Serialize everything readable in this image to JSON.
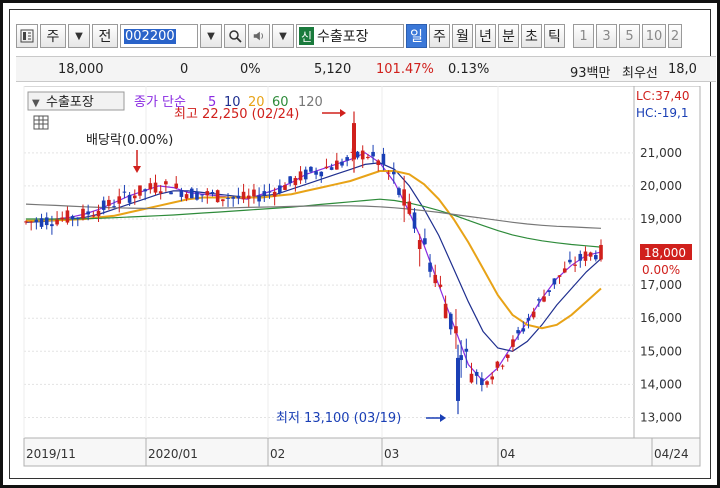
{
  "toolbar": {
    "market_label": "주",
    "jeon_label": "전",
    "stock_code": "002200",
    "stock_name_badge": "신",
    "stock_name": "수출포장",
    "periods": [
      "일",
      "주",
      "월",
      "년",
      "분",
      "초",
      "틱"
    ],
    "active_period": "일",
    "numbers": [
      "1",
      "3",
      "5",
      "10",
      "2"
    ]
  },
  "quote": {
    "price": "18,000",
    "change": "0",
    "change_pct": "0%",
    "volume": "5,120",
    "vol_ratio": "101.47%",
    "turnover": "0.13%",
    "amount": "93백만",
    "best_bid_label": "최우선",
    "best_bid": "18,0"
  },
  "chart": {
    "series_label": "수출포장",
    "ma_label": "종가 단순",
    "ma_periods": [
      {
        "label": "5",
        "color": "#8a2be2"
      },
      {
        "label": "10",
        "color": "#1f2f8f"
      },
      {
        "label": "20",
        "color": "#e8a317"
      },
      {
        "label": "60",
        "color": "#2e8b3a"
      },
      {
        "label": "120",
        "color": "#777777"
      }
    ],
    "lc_label": "LC:37,40",
    "hc_label": "HC:-19,1",
    "high_label": "최고 22,250 (02/24)",
    "low_label": "최저 13,100 (03/19)",
    "dividend_label": "배당락(0.00%)",
    "current_price": "18,000",
    "current_pct": "0.00%",
    "up_color": "#d0201c",
    "down_color": "#1a3fb5"
  },
  "chart_data": {
    "type": "candlestick",
    "ylim": [
      12500,
      22900
    ],
    "y_ticks": [
      "21,000",
      "20,000",
      "19,000",
      "17,000",
      "16,000",
      "15,000",
      "14,000",
      "13,000"
    ],
    "x_ticks": [
      "2019/11",
      "2020/01",
      "02",
      "03",
      "04",
      "04/24"
    ],
    "series": [
      {
        "name": "5",
        "values": [
          18900,
          18950,
          19000,
          19050,
          19150,
          19300,
          19500,
          19700,
          19850,
          20000,
          19950,
          19800,
          19750,
          19700,
          19650,
          19600,
          19750,
          19900,
          20100,
          20350,
          20500,
          20650,
          20800,
          21000,
          20700,
          20100,
          19200,
          18200,
          17000,
          15800,
          14600,
          14100,
          14500,
          15200,
          15900,
          16600,
          17200,
          17600,
          17900,
          18000
        ]
      },
      {
        "name": "10",
        "values": [
          18900,
          18920,
          18950,
          19000,
          19050,
          19150,
          19300,
          19450,
          19600,
          19750,
          19850,
          19850,
          19800,
          19750,
          19700,
          19650,
          19700,
          19750,
          19900,
          20050,
          20200,
          20350,
          20500,
          20650,
          20700,
          20500,
          20000,
          19300,
          18500,
          17500,
          16500,
          15600,
          15100,
          15000,
          15300,
          15800,
          16400,
          16900,
          17400,
          17800
        ]
      },
      {
        "name": "20",
        "values": [
          18950,
          18950,
          18960,
          18980,
          19000,
          19050,
          19100,
          19200,
          19300,
          19400,
          19500,
          19600,
          19650,
          19650,
          19650,
          19650,
          19650,
          19700,
          19750,
          19850,
          19950,
          20050,
          20150,
          20300,
          20450,
          20450,
          20350,
          20050,
          19600,
          19000,
          18300,
          17500,
          16700,
          16100,
          15800,
          15700,
          15800,
          16100,
          16500,
          16900
        ]
      },
      {
        "name": "60",
        "values": [
          19000,
          19000,
          19000,
          19000,
          19010,
          19020,
          19040,
          19060,
          19080,
          19100,
          19120,
          19150,
          19180,
          19210,
          19240,
          19270,
          19300,
          19330,
          19360,
          19400,
          19440,
          19480,
          19520,
          19560,
          19600,
          19560,
          19480,
          19380,
          19260,
          19120,
          18960,
          18800,
          18650,
          18520,
          18420,
          18340,
          18280,
          18230,
          18190,
          18150
        ]
      },
      {
        "name": "120",
        "values": [
          19450,
          19430,
          19410,
          19390,
          19370,
          19350,
          19340,
          19330,
          19320,
          19310,
          19310,
          19310,
          19320,
          19330,
          19340,
          19350,
          19360,
          19370,
          19380,
          19390,
          19400,
          19400,
          19400,
          19390,
          19370,
          19340,
          19300,
          19250,
          19200,
          19140,
          19080,
          19020,
          18960,
          18900,
          18850,
          18810,
          18780,
          18760,
          18740,
          18720
        ]
      }
    ],
    "high": {
      "value": 22250,
      "date": "02/24"
    },
    "low": {
      "value": 13100,
      "date": "03/19"
    }
  }
}
